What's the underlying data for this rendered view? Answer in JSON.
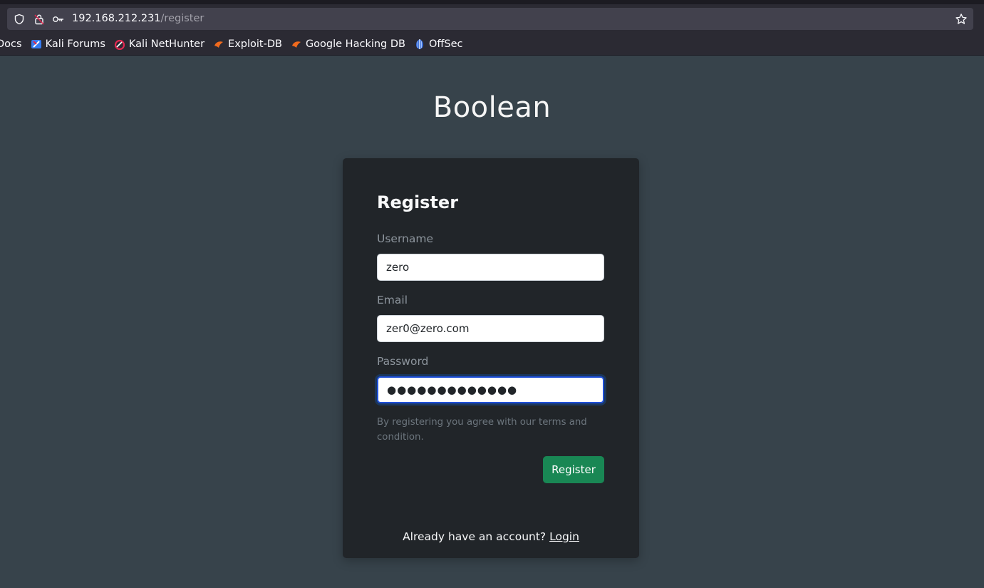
{
  "browser": {
    "url_host": "192.168.212.231",
    "url_path": "/register",
    "bookmarks": [
      {
        "label": "Docs",
        "icon": "none"
      },
      {
        "label": "Kali Forums",
        "icon": "kali-forums-icon"
      },
      {
        "label": "Kali NetHunter",
        "icon": "kali-nethunter-icon"
      },
      {
        "label": "Exploit-DB",
        "icon": "exploit-db-icon"
      },
      {
        "label": "Google Hacking DB",
        "icon": "exploit-db-icon"
      },
      {
        "label": "OffSec",
        "icon": "offsec-icon"
      }
    ]
  },
  "page": {
    "site_title": "Boolean"
  },
  "form": {
    "heading": "Register",
    "username_label": "Username",
    "username_value": "zero",
    "email_label": "Email",
    "email_value": "zer0@zero.com",
    "password_label": "Password",
    "password_masked": "●●●●●●●●●●●●●",
    "terms_text": "By registering you agree with our terms and condition.",
    "submit_label": "Register",
    "login_prompt": "Already have an account?",
    "login_link": "Login"
  },
  "colors": {
    "page_background": "#37434b",
    "card_background": "#212529",
    "button_green": "#198754",
    "focus_border": "#1d4ed8"
  }
}
